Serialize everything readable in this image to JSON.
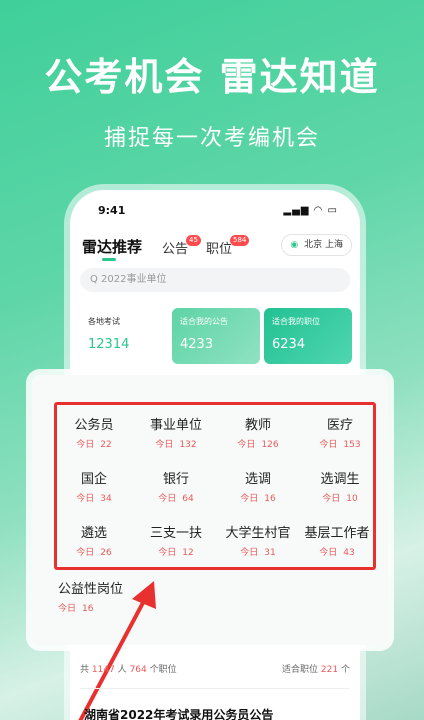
{
  "hero": {
    "title": "公考机会 雷达知道",
    "subtitle": "捕捉每一次考编机会"
  },
  "status_bar": {
    "time": "9:41",
    "icons": "▂▄▆ ◠ ▭"
  },
  "nav": {
    "tabs": [
      {
        "label": "雷达推荐",
        "badge": ""
      },
      {
        "label": "公告",
        "badge": "45"
      },
      {
        "label": "职位",
        "badge": "584"
      }
    ],
    "location": "北京 上海",
    "location_icon": "◉"
  },
  "search": {
    "placeholder": "Q 2022事业单位"
  },
  "stat_cards": [
    {
      "label": "各地考试",
      "value": "12314"
    },
    {
      "label": "适合我的公告",
      "value": "4233"
    },
    {
      "label": "适合我的职位",
      "value": "6234"
    }
  ],
  "categories": [
    {
      "name": "公务员",
      "today_label": "今日",
      "count": "22"
    },
    {
      "name": "事业单位",
      "today_label": "今日",
      "count": "132"
    },
    {
      "name": "教师",
      "today_label": "今日",
      "count": "126"
    },
    {
      "name": "医疗",
      "today_label": "今日",
      "count": "153"
    },
    {
      "name": "国企",
      "today_label": "今日",
      "count": "34"
    },
    {
      "name": "银行",
      "today_label": "今日",
      "count": "64"
    },
    {
      "name": "选调",
      "today_label": "今日",
      "count": "16"
    },
    {
      "name": "选调生",
      "today_label": "今日",
      "count": "10"
    },
    {
      "name": "遴选",
      "today_label": "今日",
      "count": "26"
    },
    {
      "name": "三支一扶",
      "today_label": "今日",
      "count": "12"
    },
    {
      "name": "大学生村官",
      "today_label": "今日",
      "count": "31"
    },
    {
      "name": "基层工作者",
      "today_label": "今日",
      "count": "43"
    },
    {
      "name": "公益性岗位",
      "today_label": "今日",
      "count": "16"
    }
  ],
  "bottom": {
    "left_prefix": "共",
    "people": "1147",
    "people_unit": "人",
    "jobs": "764",
    "jobs_unit": "个职位",
    "right_prefix": "适合职位",
    "fit": "221",
    "fit_unit": "个",
    "article_title": "湖南省2022年考试录用公务员公告"
  },
  "colors": {
    "accent": "#2cc58e",
    "highlight_red": "#e8302f",
    "count_red": "#e95a5a"
  }
}
